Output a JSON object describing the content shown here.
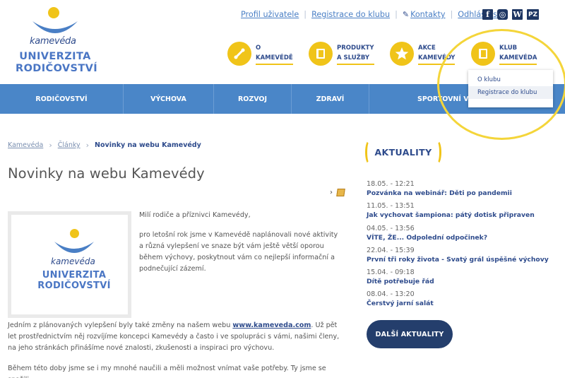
{
  "logo": {
    "brand": "kamevéda",
    "line1": "UNIVERZITA",
    "line2": "RODIČOVSTVÍ"
  },
  "toplinks": [
    {
      "label": "Profil uživatele"
    },
    {
      "label": "Registrace do klubu"
    },
    {
      "label": "Kontakty",
      "icon": "pencil-icon"
    },
    {
      "label": "Odhlásit se"
    }
  ],
  "social": [
    {
      "name": "facebook-icon",
      "glyph": "f"
    },
    {
      "name": "instagram-icon",
      "glyph": "◎"
    },
    {
      "name": "wikipedia-icon",
      "glyph": "W"
    },
    {
      "name": "pz-icon",
      "glyph": "PZ"
    }
  ],
  "circle_nav": [
    {
      "line1": "O",
      "line2": "KAMEVÉDĚ",
      "icon": "link-icon"
    },
    {
      "line1": "PRODUKTY",
      "line2": "A SLUŽBY",
      "icon": "book-icon"
    },
    {
      "line1": "AKCE",
      "line2": "KAMEVÉDY",
      "icon": "star-icon"
    },
    {
      "line1": "KLUB",
      "line2": "KAMEVÉDA",
      "icon": "book-icon"
    }
  ],
  "dropdown": {
    "items": [
      "O klubu",
      "Registrace do klubu"
    ],
    "highlighted": "Registrace do klubu"
  },
  "main_nav": [
    "RODIČOVSTVÍ",
    "VÝCHOVA",
    "ROZVOJ",
    "ZDRAVÍ",
    "SPORTOVNÍ VÝCHOVA"
  ],
  "breadcrumb": {
    "items": [
      "Kamevéda",
      "Články"
    ],
    "current": "Novinky na webu Kamevédy"
  },
  "article": {
    "title": "Novinky na webu Kamevédy",
    "p1": "Milí rodiče a příznivci Kamevédy,",
    "p2": "pro letošní rok jsme v Kamevédě naplánovali nové aktivity a různá vylepšení ve snaze být vám ještě větší oporou během výchovy, poskytnout vám co nejlepší informační a podnečující zázemí.",
    "p3_before": "Jedním z plánovaných vylepšení byly také změny na našem webu ",
    "p3_link": "www.kameveda.com",
    "p3_after": ". Už pět let prostřednictvím něj rozvíjíme koncepci Kamevédy a často i ve spolupráci s vámi, našimi členy, na jeho stránkách přinášíme nové znalosti, zkušenosti a inspiraci pro výchovu.",
    "p4": "Během této doby jsme se i my mnohé naučili a měli možnost vnímat vaše potřeby. Ty jsme se snažili"
  },
  "sidebar": {
    "title": "AKTUALITY",
    "news": [
      {
        "date": "18.05. - 12:21",
        "title": "Pozvánka na webinář: Děti po pandemii"
      },
      {
        "date": "11.05. - 13:51",
        "title": "Jak vychovat šampiona: pátý dotisk připraven"
      },
      {
        "date": "04.05. - 13:56",
        "title": "VÍTE, ŽE... Odpolední odpočinek?"
      },
      {
        "date": "22.04. - 15:39",
        "title": "První tři roky života - Svatý grál úspěšné výchovy"
      },
      {
        "date": "15.04. - 09:18",
        "title": "Dítě potřebuje řád"
      },
      {
        "date": "08.04. - 13:20",
        "title": "Čerstvý jarní salát"
      }
    ],
    "more_button": "DALŠÍ AKTUALITY"
  },
  "colors": {
    "accent_yellow": "#f0c419",
    "nav_blue": "#4a86c8",
    "dark_navy": "#243e6c",
    "link_blue": "#4a7fc5"
  }
}
